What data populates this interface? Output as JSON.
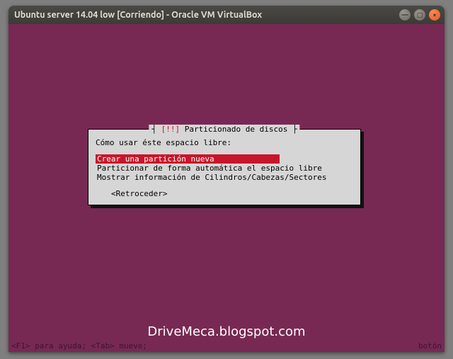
{
  "window": {
    "title": "Ubuntu server 14.04 low [Corriendo] - Oracle VM VirtualBox",
    "buttons": {
      "min": "—",
      "max": "▢",
      "close": "×"
    }
  },
  "dialog": {
    "bang": "[!!]",
    "title": " Particionado de discos ",
    "prompt": "Cómo usar éste espacio libre:",
    "items": [
      "Crear una partición nueva",
      "Particionar de forma automática el espacio libre",
      "Mostrar información de Cilindros/Cabezas/Sectores"
    ],
    "selected_index": 0,
    "back": "<Retroceder>"
  },
  "helpbar": {
    "left": "<F1> para ayuda; <Tab> mueve;",
    "right": "botón"
  },
  "watermark": "DriveMeca.blogspot.com"
}
